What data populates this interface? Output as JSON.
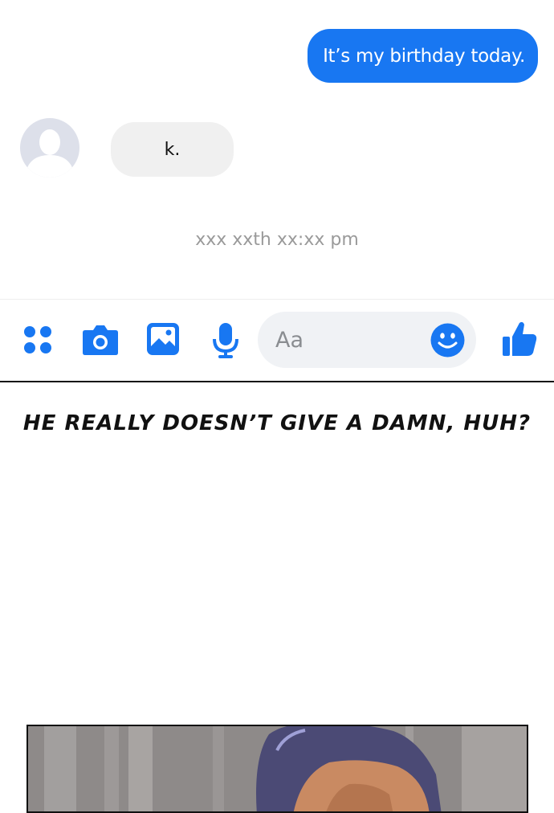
{
  "messages": {
    "outgoing": {
      "text": "It’s my birthday today."
    },
    "incoming": {
      "text": "k."
    },
    "timestamp": "xxx xxth xx:xx pm"
  },
  "composer": {
    "placeholder": "Aa"
  },
  "toolbar": {
    "icons": [
      "menu-dots-icon",
      "camera-icon",
      "image-icon",
      "microphone-icon",
      "emoji-icon",
      "thumbs-up-icon"
    ],
    "accent_color": "#1877f2"
  },
  "caption": "HE REALLY DOESN’T GIVE A DAMN, HUH?"
}
